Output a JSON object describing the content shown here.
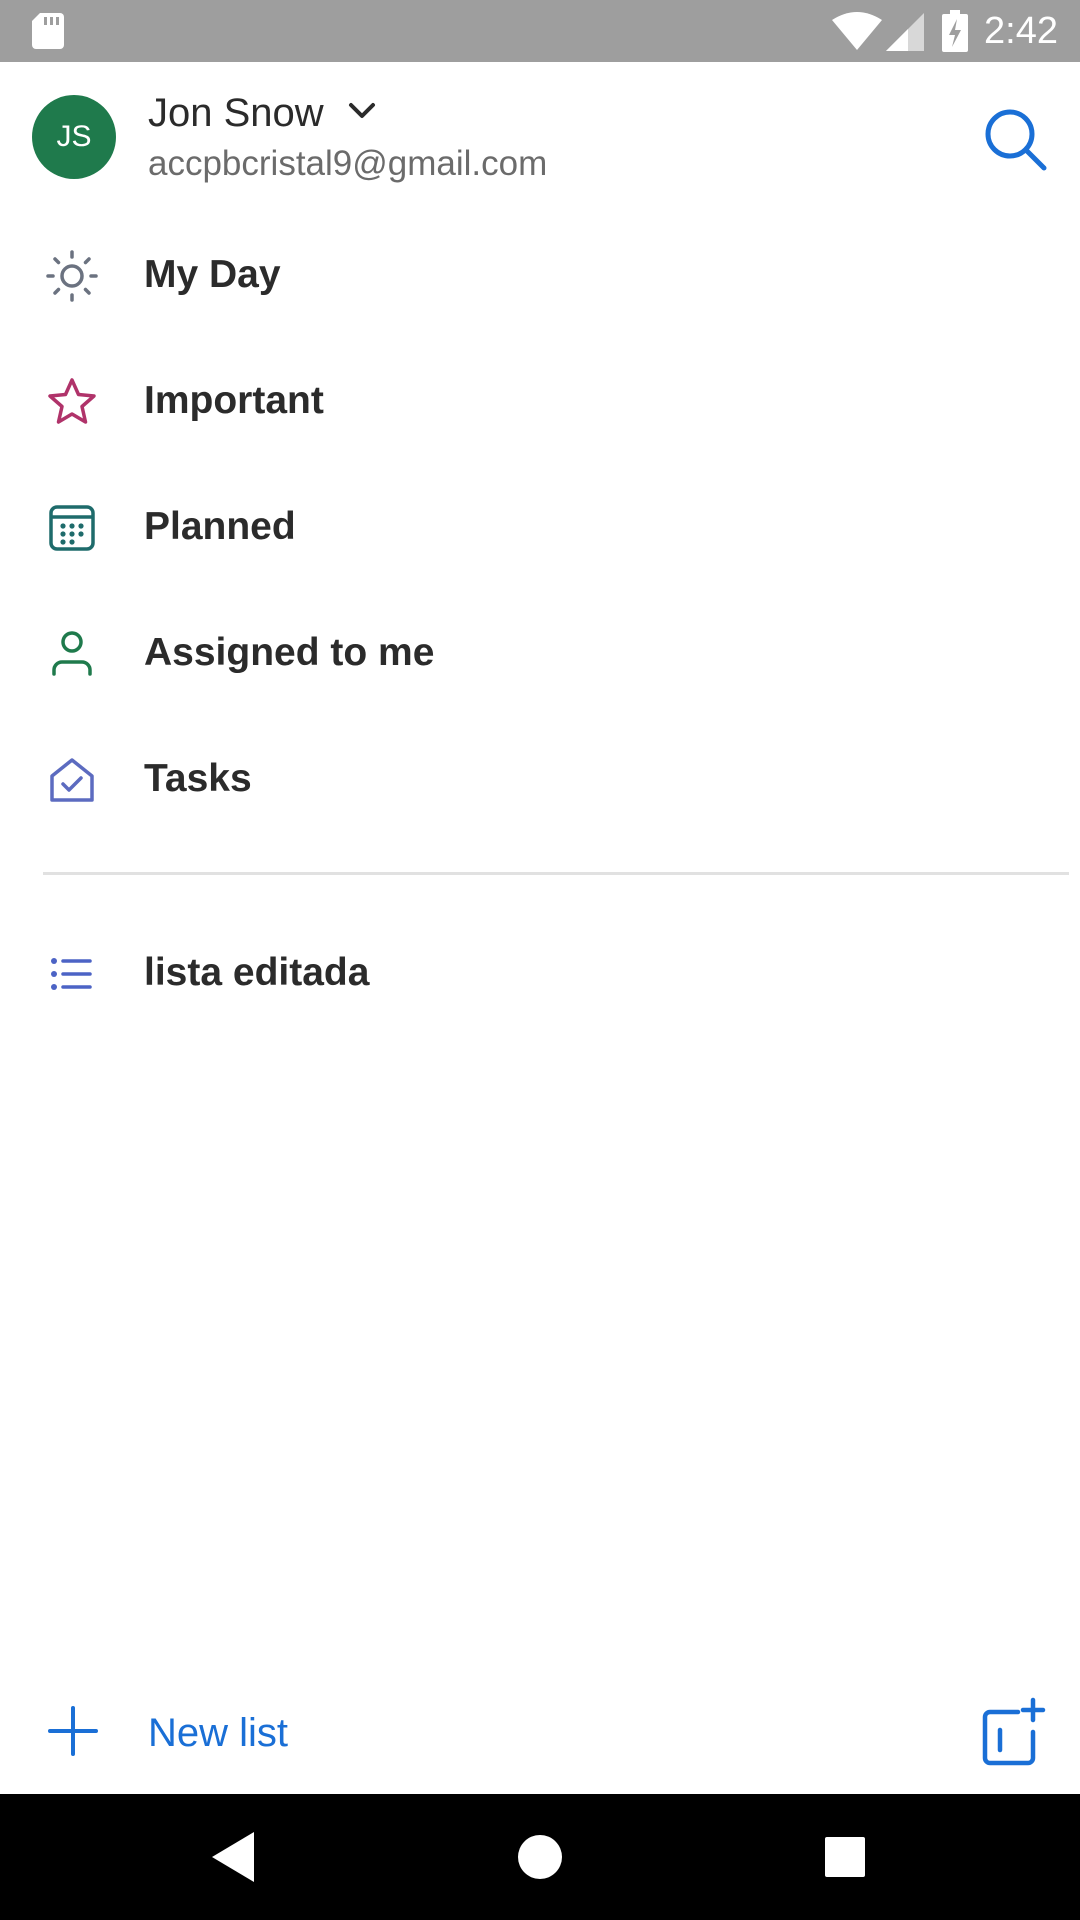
{
  "status_bar": {
    "time": "2:42"
  },
  "account": {
    "initials": "JS",
    "name": "Jon Snow",
    "email": "accpbcristal9@gmail.com",
    "avatar_color": "#1f7a4c"
  },
  "nav": {
    "items": [
      {
        "label": "My Day",
        "icon": "sun-icon",
        "color": "#6b7280"
      },
      {
        "label": "Important",
        "icon": "star-icon",
        "color": "#b0336a"
      },
      {
        "label": "Planned",
        "icon": "calendar-icon",
        "color": "#1e6b6b"
      },
      {
        "label": "Assigned to me",
        "icon": "person-icon",
        "color": "#1f7a4c"
      },
      {
        "label": "Tasks",
        "icon": "home-check-icon",
        "color": "#5c6bc0"
      }
    ]
  },
  "lists": {
    "items": [
      {
        "label": "lista editada",
        "icon": "list-icon",
        "color": "#4c63c5"
      }
    ]
  },
  "bottom": {
    "new_list_label": "New list",
    "accent_color": "#1a6fd6"
  }
}
